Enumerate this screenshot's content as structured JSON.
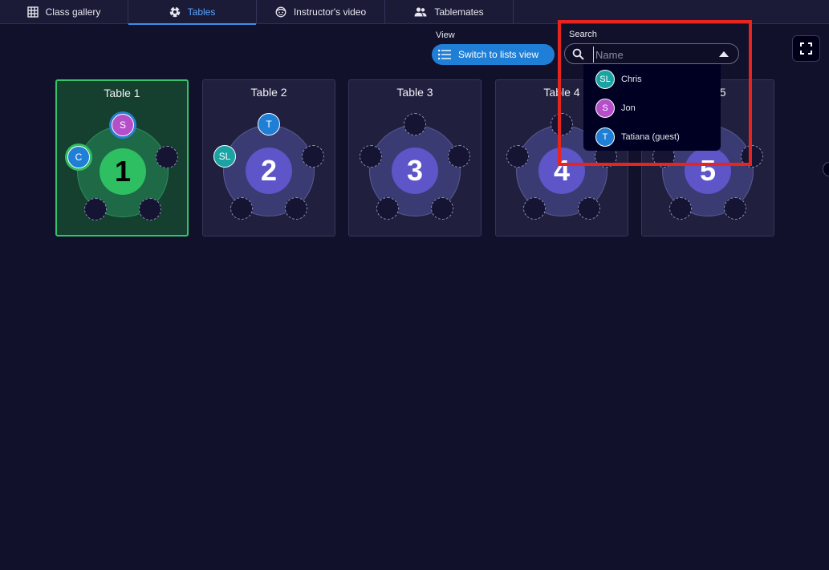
{
  "tabs": [
    {
      "label": "Class gallery",
      "icon": "grid-icon",
      "active": false
    },
    {
      "label": "Tables",
      "icon": "soccer-ball-icon",
      "active": true
    },
    {
      "label": "Instructor's video",
      "icon": "face-icon",
      "active": false
    },
    {
      "label": "Tablemates",
      "icon": "people-icon",
      "active": false
    }
  ],
  "view": {
    "label": "View",
    "switch_label": "Switch to lists view"
  },
  "search": {
    "label": "Search",
    "placeholder": "Name",
    "value": "",
    "results": [
      {
        "initials": "SL",
        "name": "Chris",
        "color": "#1ba3a3"
      },
      {
        "initials": "S",
        "name": "Jon",
        "color": "#b44fc9"
      },
      {
        "initials": "T",
        "name": "Tatiana (guest)",
        "color": "#1f7fd6"
      }
    ]
  },
  "tables": [
    {
      "title": "Table 1",
      "number": "1",
      "selected": true,
      "occupants": [
        {
          "initials": "S",
          "color": "#b44fc9",
          "seat": 0
        },
        {
          "initials": "C",
          "color": "#1f7fd6",
          "seat": 4
        }
      ]
    },
    {
      "title": "Table 2",
      "number": "2",
      "selected": false,
      "occupants": [
        {
          "initials": "T",
          "color": "#1f7fd6",
          "seat": 0
        },
        {
          "initials": "SL",
          "color": "#1ba3a3",
          "seat": 4
        }
      ]
    },
    {
      "title": "Table 3",
      "number": "3",
      "selected": false,
      "occupants": []
    },
    {
      "title": "Table 4",
      "number": "4",
      "selected": false,
      "occupants": []
    },
    {
      "title": "Table 5",
      "number": "5",
      "selected": false,
      "occupants": []
    }
  ],
  "colors": {
    "accent": "#1f7fd6",
    "selected_table": "#2fbf63",
    "highlight": "#e8241f"
  }
}
